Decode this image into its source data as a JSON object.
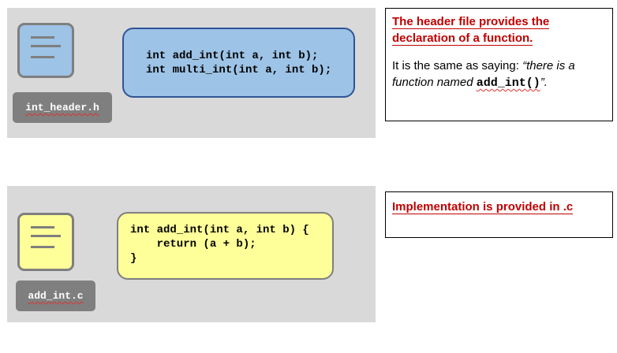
{
  "header_block": {
    "code_lines": [
      "int add_int(int a, int b);",
      "int multi_int(int a, int b);"
    ],
    "filename": "int_header.h",
    "icon_color": "#9dc3e6",
    "box_color": "#9dc3e6",
    "box_border": "#2f5597"
  },
  "impl_block": {
    "code_lines": [
      "int add_int(int a, int b) {",
      "    return (a + b);",
      "}"
    ],
    "filename": "add_int.c",
    "icon_color": "#ffff99",
    "box_color": "#ffff99",
    "box_border": "#7f7f7f"
  },
  "note_header": {
    "heading_line1": "The header file provides the",
    "heading_line2": "declaration of a function.",
    "body_prefix": "It is the same as saying: ",
    "body_quote_open": "“there is a",
    "body_line2_prefix": "function named ",
    "function_name": "add_int()",
    "body_line2_suffix": "”."
  },
  "note_impl": {
    "heading": "Implementation is provided in .c"
  },
  "colors": {
    "panel": "#d9d9d9",
    "accent_red": "#c00000",
    "label_bg": "#7f7f7f"
  }
}
